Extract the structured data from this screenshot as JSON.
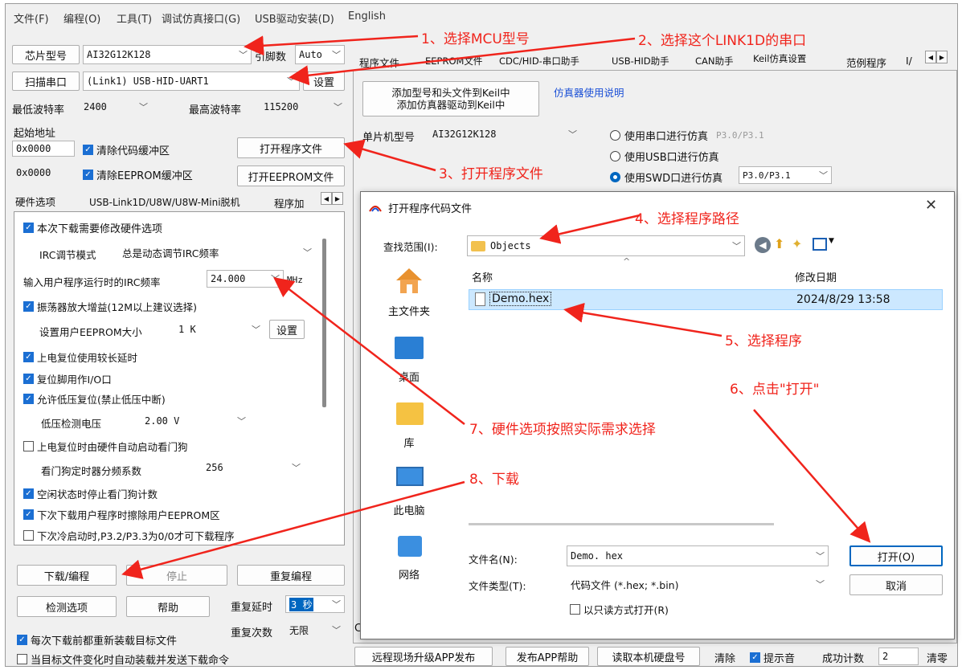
{
  "menu": [
    "文件(F)",
    "编程(O)",
    "工具(T)",
    "调试仿真接口(G)",
    "USB驱动安装(D)",
    "English"
  ],
  "left": {
    "chip_label": "芯片型号",
    "chip_value": "AI32G12K128",
    "pin_label": "引脚数",
    "pin_value": "Auto",
    "scan_label": "扫描串口",
    "port_value": "(Link1) USB-HID-UART1",
    "settings_label": "设置",
    "min_baud_label": "最低波特率",
    "min_baud_value": "2400",
    "max_baud_label": "最高波特率",
    "max_baud_value": "115200",
    "start_addr_label": "起始地址",
    "addr1": "0x0000",
    "clear_code": "清除代码缓冲区",
    "open_prog": "打开程序文件",
    "addr2": "0x0000",
    "clear_eeprom": "清除EEPROM缓冲区",
    "open_eeprom": "打开EEPROM文件",
    "subtabs": [
      "硬件选项",
      "USB-Link1D/U8W/U8W-Mini脱机",
      "程序加"
    ],
    "hw": {
      "modify": "本次下载需要修改硬件选项",
      "irc_mode_label": "IRC调节模式",
      "irc_mode_value": "总是动态调节IRC频率",
      "irc_freq_label": "输入用户程序运行时的IRC频率",
      "irc_freq_value": "24.000",
      "irc_unit": "MHz",
      "osc_gain": "振荡器放大增益(12M以上建议选择)",
      "eeprom_size_label": "设置用户EEPROM大小",
      "eeprom_size_value": "1   K",
      "eeprom_set": "设置",
      "long_delay": "上电复位使用较长延时",
      "reset_io": "复位脚用作I/O口",
      "low_v_reset": "允许低压复位(禁止低压中断)",
      "low_v_label": "低压检测电压",
      "low_v_value": "2.00 V",
      "wdt_auto": "上电复位时由硬件自动启动看门狗",
      "wdt_div_label": "看门狗定时器分频系数",
      "wdt_div_value": "256",
      "idle_stop_wdt": "空闲状态时停止看门狗计数",
      "erase_eeprom": "下次下载用户程序时擦除用户EEPROM区",
      "cold_boot": "下次冷启动时,P3.2/P3.3为0/0才可下载程序"
    },
    "download": "下载/编程",
    "stop": "停止",
    "reprog": "重复编程",
    "detect": "检测选项",
    "help": "帮助",
    "repeat_delay_label": "重复延时",
    "repeat_delay_value": "3 秒",
    "repeat_count_label": "重复次数",
    "repeat_count_value": "无限",
    "reload_each": "每次下载前都重新装载目标文件",
    "auto_load": "当目标文件变化时自动装载并发送下载命令"
  },
  "right": {
    "tabs": [
      "程序文件",
      "EEPROM文件",
      "CDC/HID-串口助手",
      "USB-HID助手",
      "CAN助手",
      "Keil仿真设置",
      "范例程序",
      "I/"
    ],
    "keil_btn_line1": "添加型号和头文件到Keil中",
    "keil_btn_line2": "添加仿真器驱动到Keil中",
    "sim_help": "仿真器使用说明",
    "mcu_label": "单片机型号",
    "mcu_value": "AI32G12K128",
    "radio_serial": "使用串口进行仿真",
    "radio_serial_port": "P3.0/P3.1",
    "radio_usb": "使用USB口进行仿真",
    "radio_swd": "使用SWD口进行仿真",
    "radio_swd_port": "P3.0/P3.1",
    "bottom": [
      "远程现场升级APP发布",
      "发布APP帮助",
      "读取本机硬盘号",
      "清除",
      "提示音",
      "成功计数",
      "2",
      "清零"
    ],
    "stray_c": "C"
  },
  "dialog": {
    "title": "打开程序代码文件",
    "lookin_label": "查找范围(I):",
    "lookin_value": "Objects",
    "col_name": "名称",
    "col_date": "修改日期",
    "file_name": "Demo.hex",
    "file_date": "2024/8/29 13:58",
    "nav": [
      "主文件夹",
      "桌面",
      "库",
      "此电脑",
      "网络"
    ],
    "filename_label": "文件名(N):",
    "filename_value": "Demo. hex",
    "filetype_label": "文件类型(T):",
    "filetype_value": "代码文件 (*.hex; *.bin)",
    "readonly": "以只读方式打开(R)",
    "open_btn": "打开(O)",
    "cancel_btn": "取消"
  },
  "annotations": [
    "1、选择MCU型号",
    "2、选择这个LINK1D的串口",
    "3、打开程序文件",
    "4、选择程序路径",
    "5、选择程序",
    "6、点击\"打开\"",
    "7、硬件选项按照实际需求选择",
    "8、下载"
  ],
  "colors": {
    "annotation": "#f0241c",
    "accent": "#0067c0",
    "checkbox": "#1b6fd3"
  }
}
